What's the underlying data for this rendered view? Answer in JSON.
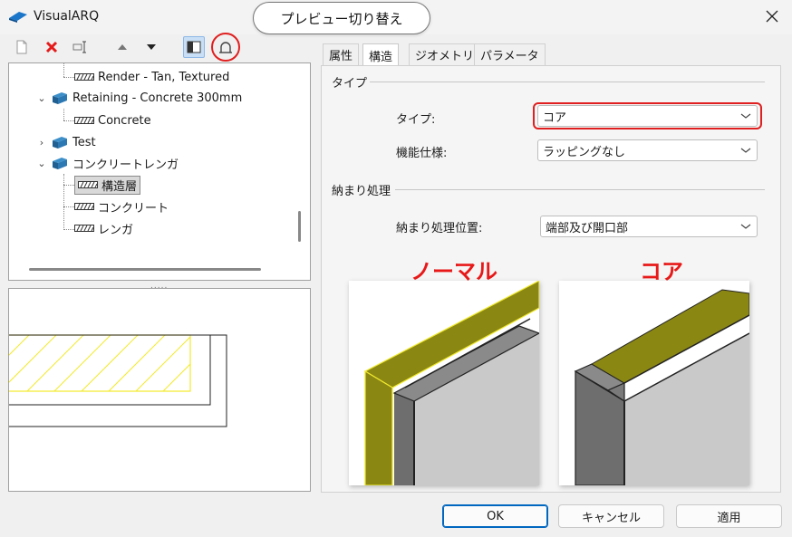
{
  "window": {
    "title": "VisualARQ",
    "close_icon": "close-icon"
  },
  "callout": {
    "text": "プレビュー切り替え"
  },
  "toolbar": {
    "icons": [
      "new-style-icon",
      "delete-icon",
      "rename-icon",
      "move-up-icon",
      "move-down-icon",
      "preview-toggle-icon",
      "preview-switch-icon"
    ]
  },
  "tree": {
    "items": [
      {
        "label": "Render - Tan, Textured"
      },
      {
        "label": "Retaining - Concrete 300mm"
      },
      {
        "label": "Concrete"
      },
      {
        "label": "Test"
      },
      {
        "label": "コンクリートレンガ"
      },
      {
        "label": "構造層"
      },
      {
        "label": "コンクリート"
      },
      {
        "label": "レンガ"
      }
    ],
    "splitter": "....."
  },
  "tabs": [
    {
      "label": "属性"
    },
    {
      "label": "構造"
    },
    {
      "label": "ジオメトリ"
    },
    {
      "label": "パラメータ"
    }
  ],
  "type_section": {
    "title": "タイプ",
    "type_label": "タイプ:",
    "type_value": "コア",
    "function_label": "機能仕様:",
    "function_value": "ラッピングなし"
  },
  "finish_section": {
    "title": "納まり処理",
    "position_label": "納まり処理位置:",
    "position_value": "端部及び開口部"
  },
  "examples": {
    "normal": "ノーマル",
    "core": "コア"
  },
  "buttons": {
    "ok": "OK",
    "cancel": "キャンセル",
    "apply": "適用"
  },
  "colors": {
    "highlight": "#e02020",
    "accent": "#0067c0",
    "layer_yellow": "#8a8610"
  }
}
